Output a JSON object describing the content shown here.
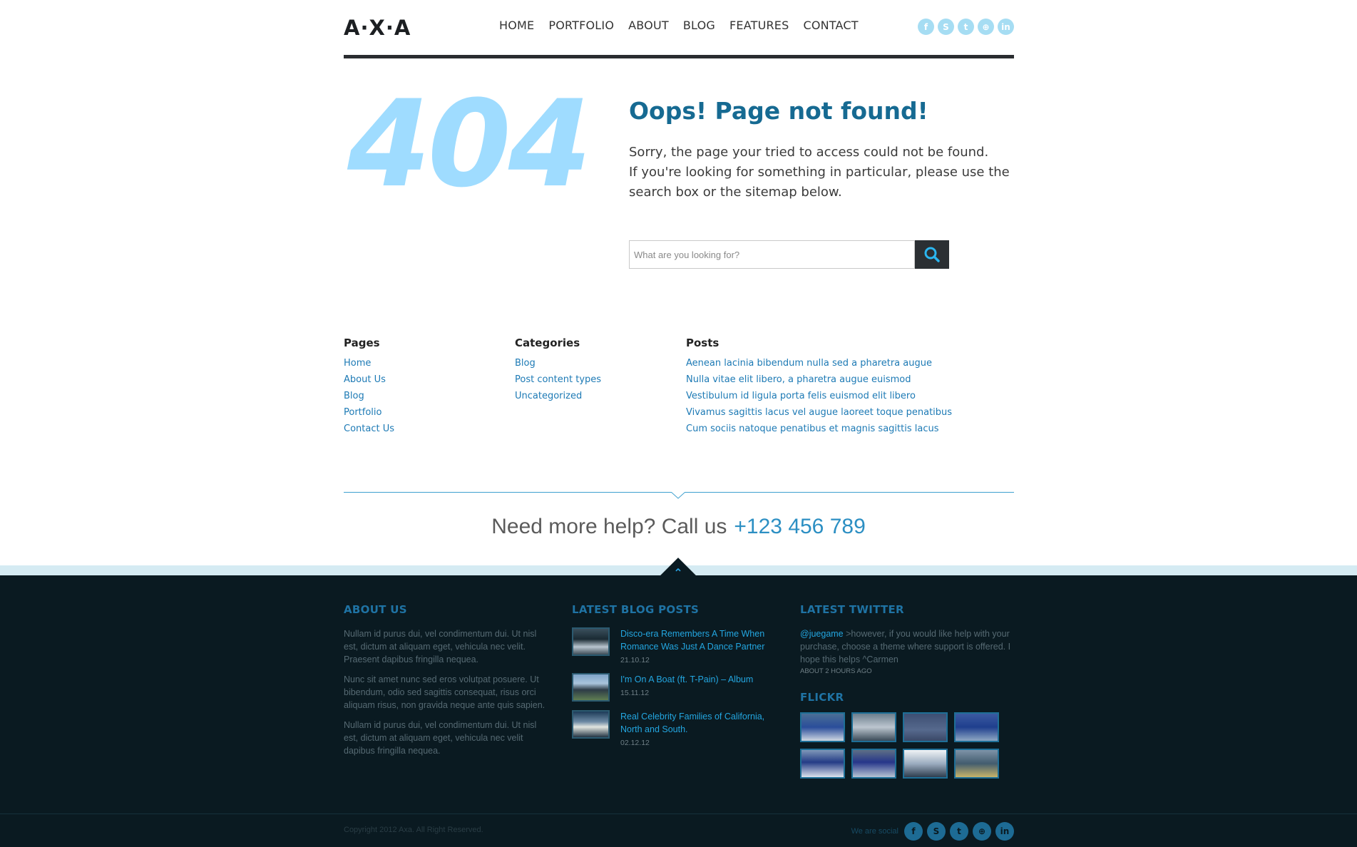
{
  "header": {
    "logo": "A·X·A",
    "nav": [
      "HOME",
      "PORTFOLIO",
      "ABOUT",
      "BLOG",
      "FEATURES",
      "CONTACT"
    ],
    "social_icons": [
      "facebook-icon",
      "skype-icon",
      "twitter-icon",
      "dribbble-icon",
      "linkedin-icon"
    ]
  },
  "error": {
    "code": "404",
    "title": "Oops! Page not found!",
    "line1": "Sorry, the page your tried to access could not be found.",
    "line2": "If you're looking for something in particular, please use the search box or the sitemap below.",
    "search_placeholder": "What are you looking for?"
  },
  "sitemap": {
    "pages": {
      "title": "Pages",
      "items": [
        "Home",
        "About Us",
        "Blog",
        "Portfolio",
        "Contact Us"
      ]
    },
    "categories": {
      "title": "Categories",
      "items": [
        "Blog",
        "Post content types",
        "Uncategorized"
      ]
    },
    "posts": {
      "title": "Posts",
      "items": [
        "Aenean lacinia bibendum nulla sed a pharetra augue",
        "Nulla vitae elit libero, a pharetra augue euismod",
        "Vestibulum id ligula porta felis euismod elit libero",
        "Vivamus sagittis lacus vel augue laoreet toque penatibus",
        "Cum sociis natoque penatibus et magnis sagittis lacus"
      ]
    }
  },
  "help": {
    "text": "Need more help? Call us",
    "phone": "+123 456 789"
  },
  "footer": {
    "about": {
      "title": "ABOUT US",
      "paragraphs": [
        "Nullam id purus dui, vel condimentum dui. Ut nisl est, dictum at aliquam eget, vehicula nec velit. Praesent dapibus fringilla nequea.",
        "Nunc sit amet nunc sed eros volutpat posuere. Ut bibendum, odio sed sagittis consequat, risus orci aliquam risus, non gravida neque ante quis sapien.",
        "Nullam id purus dui, vel condimentum dui. Ut nisl est, dictum at aliquam eget, vehicula nec velit dapibus fringilla nequea."
      ]
    },
    "blog": {
      "title": "LATEST BLOG POSTS",
      "posts": [
        {
          "title": "Disco-era Remembers A Time When Romance Was Just A Dance Partner",
          "date": "21.10.12"
        },
        {
          "title": "I'm On A Boat (ft. T-Pain) – Album",
          "date": "15.11.12"
        },
        {
          "title": "Real Celebrity Families of California, North and South.",
          "date": "02.12.12"
        }
      ]
    },
    "twitter": {
      "title": "LATEST TWITTER",
      "handle": "@juegame",
      "text": " >however, if you would like help with your purchase, choose a theme where support is offered. I hope this helps ^Carmen",
      "time": "ABOUT 2 HOURS AGO"
    },
    "flickr": {
      "title": "FLICKR"
    },
    "copyright": "Copyright 2012 Axa. All Right Reserved.",
    "social_label": "We are social",
    "colors": {
      "accent": "#23a6e0",
      "background": "#0a1a21",
      "heading": "#1f73a4"
    }
  }
}
